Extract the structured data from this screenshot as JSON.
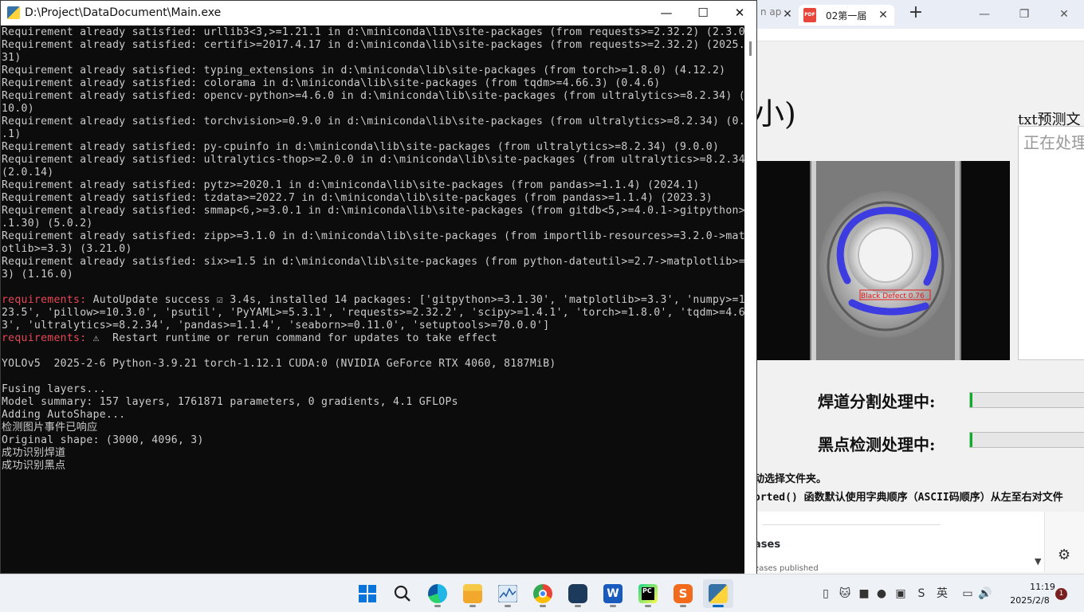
{
  "background_browser": {
    "prev_tab_label": "n ap",
    "tab_title": "02第一届",
    "app_title_fragment": "小)",
    "txt_panel_label": "txt预测文",
    "txt_panel_status": "正在处理",
    "image_detection_label": "Black Defect 0.76",
    "weld_seg_label": "焊道分割处理中:",
    "weld_seg_progress": 0.02,
    "dot_detect_label": "黑点检测处理中:",
    "dot_detect_progress": 0.02,
    "note_line_1": "动选择文件夹。",
    "note_line_2": "orted() 函数默认使用字典顺序（ASCII码顺序）从左至右对文件",
    "releases_label": "ases",
    "releases_sub": "eases published",
    "progress_color": "#06b025"
  },
  "console": {
    "title": "D:\\Project\\DataDocument\\Main.exe",
    "lines": [
      "Requirement already satisfied: urllib3<3,>=1.21.1 in d:\\miniconda\\lib\\site-packages (from requests>=2.32.2) (2.3.0)",
      "Requirement already satisfied: certifi>=2017.4.17 in d:\\miniconda\\lib\\site-packages (from requests>=2.32.2) (2025.1.",
      "31)",
      "Requirement already satisfied: typing_extensions in d:\\miniconda\\lib\\site-packages (from torch>=1.8.0) (4.12.2)",
      "Requirement already satisfied: colorama in d:\\miniconda\\lib\\site-packages (from tqdm>=4.66.3) (0.4.6)",
      "Requirement already satisfied: opencv-python>=4.6.0 in d:\\miniconda\\lib\\site-packages (from ultralytics>=8.2.34) (4.",
      "10.0)",
      "Requirement already satisfied: torchvision>=0.9.0 in d:\\miniconda\\lib\\site-packages (from ultralytics>=8.2.34) (0.13",
      ".1)",
      "Requirement already satisfied: py-cpuinfo in d:\\miniconda\\lib\\site-packages (from ultralytics>=8.2.34) (9.0.0)",
      "Requirement already satisfied: ultralytics-thop>=2.0.0 in d:\\miniconda\\lib\\site-packages (from ultralytics>=8.2.34)",
      "(2.0.14)",
      "Requirement already satisfied: pytz>=2020.1 in d:\\miniconda\\lib\\site-packages (from pandas>=1.1.4) (2024.1)",
      "Requirement already satisfied: tzdata>=2022.7 in d:\\miniconda\\lib\\site-packages (from pandas>=1.1.4) (2023.3)",
      "Requirement already satisfied: smmap<6,>=3.0.1 in d:\\miniconda\\lib\\site-packages (from gitdb<5,>=4.0.1->gitpython>=3",
      ".1.30) (5.0.2)",
      "Requirement already satisfied: zipp>=3.1.0 in d:\\miniconda\\lib\\site-packages (from importlib-resources>=3.2.0->matpl",
      "otlib>=3.3) (3.21.0)",
      "Requirement already satisfied: six>=1.5 in d:\\miniconda\\lib\\site-packages (from python-dateutil>=2.7->matplotlib>=3.",
      "3) (1.16.0)",
      "",
      "requirements:| AutoUpdate success ☑ 3.4s, installed 14 packages: ['gitpython>=3.1.30', 'matplotlib>=3.3', 'numpy>=1.",
      "23.5', 'pillow>=10.3.0', 'psutil', 'PyYAML>=5.3.1', 'requests>=2.32.2', 'scipy>=1.4.1', 'torch>=1.8.0', 'tqdm>=4.66.",
      "3', 'ultralytics>=8.2.34', 'pandas>=1.1.4', 'seaborn>=0.11.0', 'setuptools>=70.0.0']",
      "requirements:| ⚠  Restart runtime or rerun command for updates to take effect",
      "",
      "YOLOv5  2025-2-6 Python-3.9.21 torch-1.12.1 CUDA:0 (NVIDIA GeForce RTX 4060, 8187MiB)",
      "",
      "Fusing layers...",
      "Model summary: 157 layers, 1761871 parameters, 0 gradients, 4.1 GFLOPs",
      "Adding AutoShape...",
      "检测图片事件已响应",
      "Original shape: (3000, 4096, 3)",
      "成功识别焊道",
      "成功识别黑点"
    ]
  },
  "taskbar": {
    "time": "11:19",
    "date": "2025/2/8",
    "ime_label": "英",
    "notification_count": "1",
    "apps": [
      {
        "name": "start",
        "icon": "windows-logo-icon"
      },
      {
        "name": "search",
        "icon": "search-icon"
      },
      {
        "name": "edge",
        "icon": "edge-icon"
      },
      {
        "name": "file-explorer",
        "icon": "folder-icon"
      },
      {
        "name": "task-manager",
        "icon": "task-manager-icon"
      },
      {
        "name": "chrome",
        "icon": "chrome-icon"
      },
      {
        "name": "anaconda-prompt",
        "icon": "cat-icon"
      },
      {
        "name": "word",
        "icon": "word-icon"
      },
      {
        "name": "pycharm",
        "icon": "pycharm-icon"
      },
      {
        "name": "sougou-input",
        "icon": "sogou-icon"
      },
      {
        "name": "python-console",
        "icon": "python-icon"
      }
    ]
  }
}
